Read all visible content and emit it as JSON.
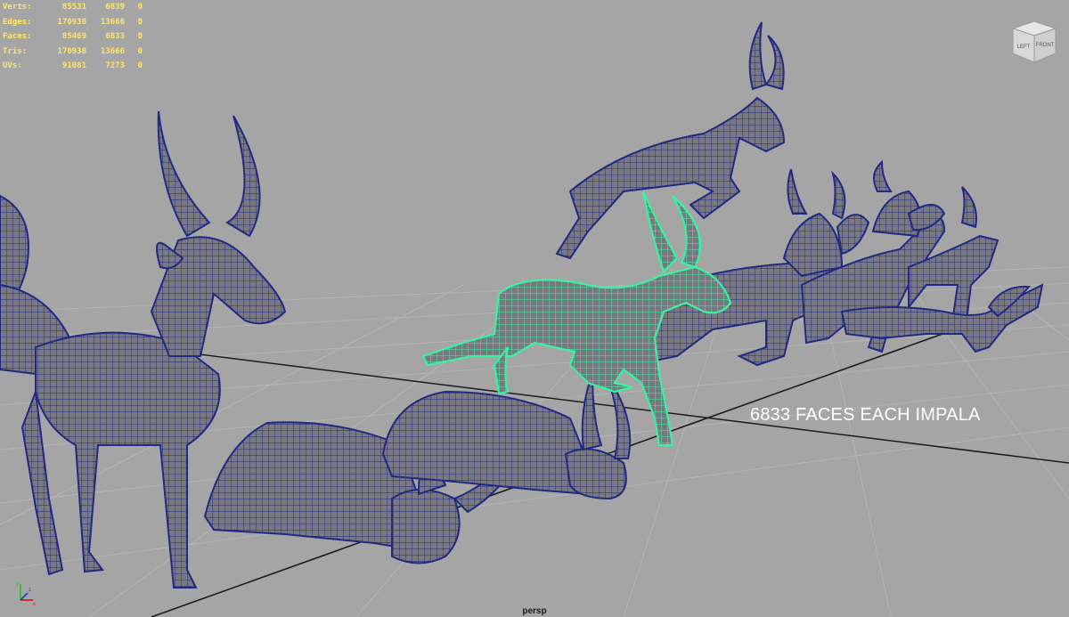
{
  "hud": {
    "rows": [
      {
        "label": "Verts:",
        "v1": "85531",
        "v2": "6839",
        "v3": "0"
      },
      {
        "label": "Edges:",
        "v1": "170938",
        "v2": "13666",
        "v3": "0"
      },
      {
        "label": "Faces:",
        "v1": "85469",
        "v2": "6833",
        "v3": "0"
      },
      {
        "label": "Tris:",
        "v1": "170938",
        "v2": "13666",
        "v3": "0"
      },
      {
        "label": "UVs:",
        "v1": "91081",
        "v2": "7273",
        "v3": "0"
      }
    ]
  },
  "viewcube": {
    "left_label": "LEFT",
    "front_label": "FRONT"
  },
  "overlay_text": "6833 FACES EACH IMPALA",
  "camera_name": "persp",
  "colors": {
    "background": "#a5a5a5",
    "grid": "#b6b6b6",
    "grid_axis": "#1a1a1a",
    "mesh_fill": "#7a7880",
    "wireframe": "#1f2a82",
    "selected_wireframe": "#3cf2a0",
    "hud_text": "#ffe86a",
    "overlay_text": "#ffffff"
  },
  "icons": [
    "axis-gizmo-icon",
    "viewcube-icon"
  ]
}
